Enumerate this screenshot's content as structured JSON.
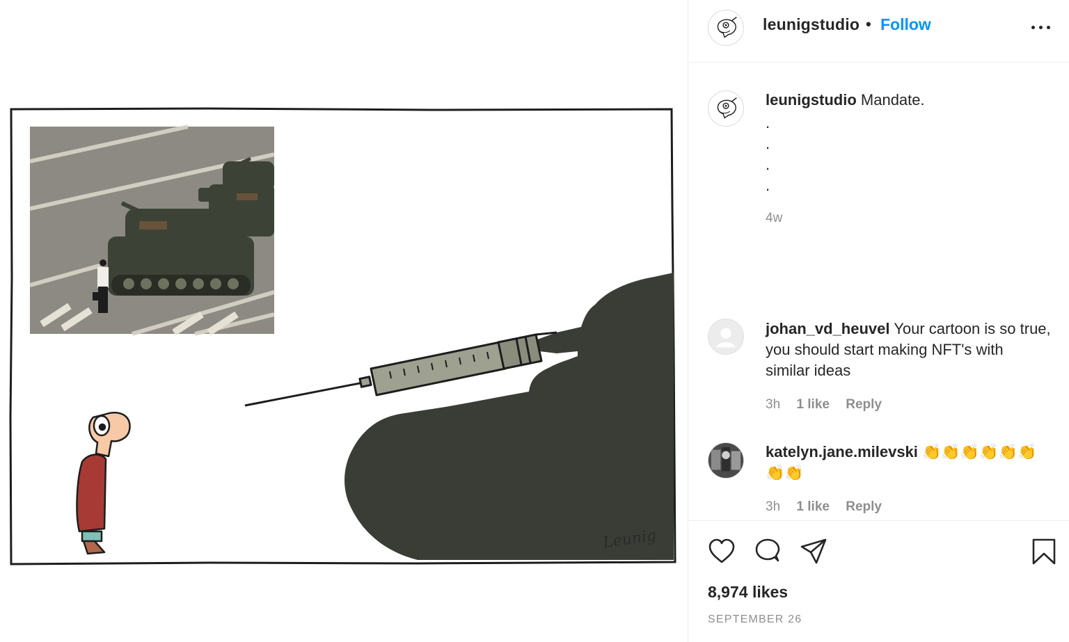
{
  "post": {
    "author": "leunigstudio",
    "follow_label": "Follow",
    "separator": "•",
    "image": {
      "signature": "Leunig"
    }
  },
  "caption": {
    "username": "leunigstudio",
    "text": "Mandate.",
    "dots": [
      ".",
      ".",
      ".",
      "."
    ],
    "time": "4w"
  },
  "comments": [
    {
      "username": "johan_vd_heuvel",
      "text": "Your cartoon is so true, you should start making NFT's with similar ideas",
      "time": "3h",
      "likes": "1 like",
      "reply": "Reply"
    },
    {
      "username": "katelyn.jane.milevski",
      "text": "👏👏👏👏👏👏👏👏",
      "time": "3h",
      "likes": "1 like",
      "reply": "Reply"
    }
  ],
  "stats": {
    "likes": "8,974 likes",
    "date": "SEPTEMBER 26"
  },
  "icons": {
    "like": "heart-icon",
    "comment": "comment-icon",
    "share": "paper-plane-icon",
    "save": "bookmark-icon",
    "more": "more-options-icon"
  },
  "colors": {
    "link_blue": "#0095f6",
    "muted": "#8e8e8e",
    "tank": "#3a3d35",
    "coat": "#a83a35"
  }
}
